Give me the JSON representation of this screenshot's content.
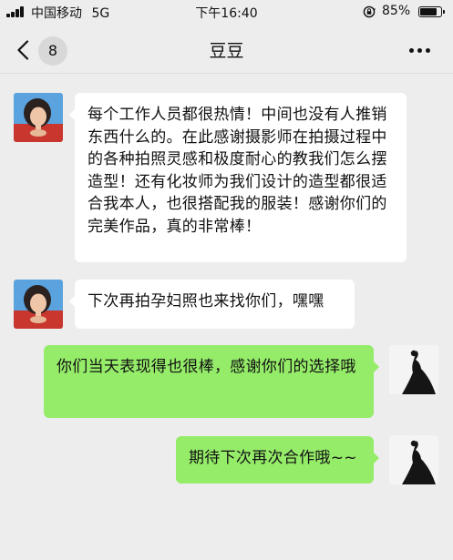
{
  "status_bar": {
    "carrier": "中国移动",
    "network": "5G",
    "time": "下午16:40",
    "battery": "85%",
    "battery_level": 0.85
  },
  "nav": {
    "back_icon": "chevron-left-icon",
    "unread_count": "8",
    "title": "豆豆",
    "more_icon": "more-dots-icon"
  },
  "messages": [
    {
      "direction": "incoming",
      "text": "每个工作人员都很热情！中间也没有人推销东西什么的。在此感谢摄影师在拍摄过程中的各种拍照灵感和极度耐心的教我们怎么摆造型！还有化妆师为我们设计的造型都很适合我本人，也很搭配我的服装！感谢你们的完美作品，真的非常棒！"
    },
    {
      "direction": "incoming",
      "text": "下次再拍孕妇照也来找你们，嘿嘿"
    },
    {
      "direction": "outgoing",
      "text": "你们当天表现得也很棒，感谢你们的选择哦"
    },
    {
      "direction": "outgoing",
      "text": "期待下次再次合作哦~~"
    }
  ],
  "colors": {
    "background": "#ededed",
    "incoming_bubble": "#ffffff",
    "outgoing_bubble": "#95ec69"
  }
}
